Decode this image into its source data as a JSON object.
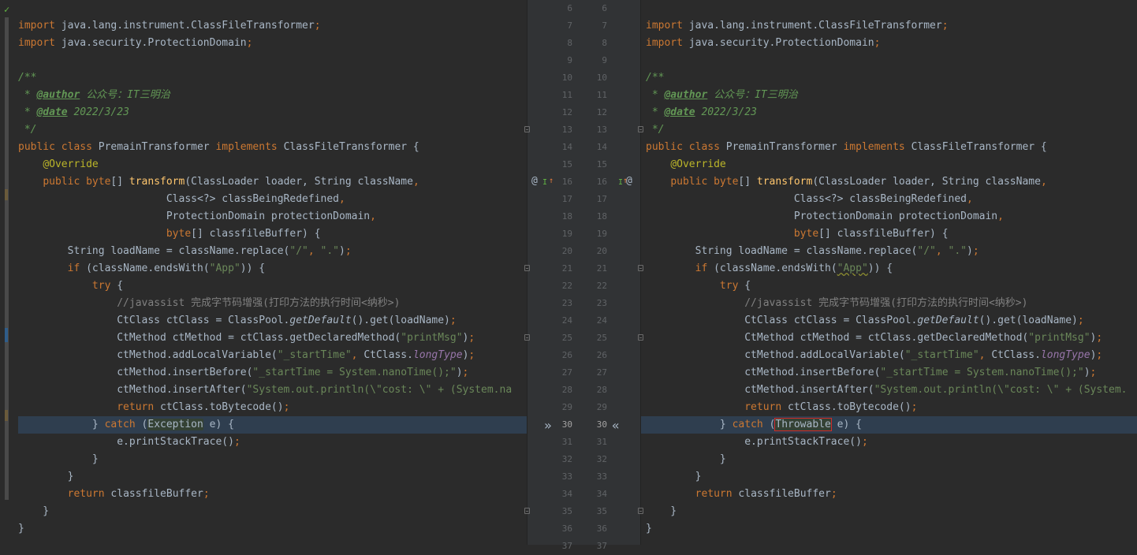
{
  "left": {
    "lines": [
      {
        "n": 7,
        "tokens": [
          [
            "k",
            "import "
          ],
          [
            "p",
            "java.lang.instrument.ClassFileTransformer"
          ],
          [
            "k",
            ";"
          ]
        ]
      },
      {
        "n": 8,
        "tokens": [
          [
            "k",
            "import "
          ],
          [
            "p",
            "java.security.ProtectionDomain"
          ],
          [
            "k",
            ";"
          ]
        ]
      },
      {
        "n": 9,
        "tokens": []
      },
      {
        "n": 10,
        "tokens": [
          [
            "dc",
            "/**"
          ]
        ]
      },
      {
        "n": 11,
        "tokens": [
          [
            "dc",
            " * "
          ],
          [
            "dt",
            "@author"
          ],
          [
            "dc",
            " 公众号：IT三明治"
          ]
        ]
      },
      {
        "n": 12,
        "tokens": [
          [
            "dc",
            " * "
          ],
          [
            "dt",
            "@date"
          ],
          [
            "dc",
            " 2022/3/23"
          ]
        ]
      },
      {
        "n": 13,
        "tokens": [
          [
            "dc",
            " */"
          ]
        ]
      },
      {
        "n": 14,
        "tokens": [
          [
            "k",
            "public class "
          ],
          [
            "p",
            "PremainTransformer "
          ],
          [
            "k",
            "implements "
          ],
          [
            "p",
            "ClassFileTransformer {"
          ]
        ]
      },
      {
        "n": 15,
        "tokens": [
          [
            "p",
            "    "
          ],
          [
            "an",
            "@Override"
          ]
        ]
      },
      {
        "n": 16,
        "tokens": [
          [
            "p",
            "    "
          ],
          [
            "k",
            "public byte"
          ],
          [
            "p",
            "[] "
          ],
          [
            "fn",
            "transform"
          ],
          [
            "p",
            "(ClassLoader loader, String className"
          ],
          [
            "k",
            ","
          ]
        ]
      },
      {
        "n": 17,
        "tokens": [
          [
            "p",
            "                        Class<?> classBeingRedefined"
          ],
          [
            "k",
            ","
          ]
        ]
      },
      {
        "n": 18,
        "tokens": [
          [
            "p",
            "                        ProtectionDomain protectionDomain"
          ],
          [
            "k",
            ","
          ]
        ]
      },
      {
        "n": 19,
        "tokens": [
          [
            "p",
            "                        "
          ],
          [
            "k",
            "byte"
          ],
          [
            "p",
            "[] classfileBuffer) {"
          ]
        ]
      },
      {
        "n": 20,
        "tokens": [
          [
            "p",
            "        String loadName = className.replace("
          ],
          [
            "s",
            "\"/\""
          ],
          [
            "k",
            ", "
          ],
          [
            "s",
            "\".\""
          ],
          [
            "p",
            ")"
          ],
          [
            "k",
            ";"
          ]
        ]
      },
      {
        "n": 21,
        "tokens": [
          [
            "p",
            "        "
          ],
          [
            "k",
            "if "
          ],
          [
            "p",
            "(className.endsWith("
          ],
          [
            "s",
            "\"App\""
          ],
          [
            "p",
            ")) {"
          ]
        ]
      },
      {
        "n": 22,
        "tokens": [
          [
            "p",
            "            "
          ],
          [
            "k",
            "try "
          ],
          [
            "p",
            "{"
          ]
        ]
      },
      {
        "n": 23,
        "tokens": [
          [
            "p",
            "                "
          ],
          [
            "c",
            "//javassist 完成字节码增强(打印方法的执行时间<纳秒>)"
          ]
        ]
      },
      {
        "n": 24,
        "tokens": [
          [
            "p",
            "                CtClass ctClass = ClassPool."
          ],
          [
            "sm",
            "getDefault"
          ],
          [
            "p",
            "().get(loadName)"
          ],
          [
            "k",
            ";"
          ]
        ]
      },
      {
        "n": 25,
        "tokens": [
          [
            "p",
            "                CtMethod ctMethod = ctClass.getDeclaredMethod("
          ],
          [
            "s",
            "\"printMsg\""
          ],
          [
            "p",
            ")"
          ],
          [
            "k",
            ";"
          ]
        ]
      },
      {
        "n": 26,
        "tokens": [
          [
            "p",
            "                ctMethod.addLocalVariable("
          ],
          [
            "s",
            "\"_startTime\""
          ],
          [
            "k",
            ", "
          ],
          [
            "p",
            "CtClass."
          ],
          [
            "it",
            "longType"
          ],
          [
            "p",
            ")"
          ],
          [
            "k",
            ";"
          ]
        ]
      },
      {
        "n": 27,
        "tokens": [
          [
            "p",
            "                ctMethod.insertBefore("
          ],
          [
            "s",
            "\"_startTime = System.nanoTime();\""
          ],
          [
            "p",
            ")"
          ],
          [
            "k",
            ";"
          ]
        ]
      },
      {
        "n": 28,
        "tokens": [
          [
            "p",
            "                ctMethod.insertAfter("
          ],
          [
            "s",
            "\"System.out.println(\\\"cost: \\\" + (System.na"
          ]
        ]
      },
      {
        "n": 29,
        "tokens": [
          [
            "p",
            "                "
          ],
          [
            "k",
            "return "
          ],
          [
            "p",
            "ctClass.toBytecode()"
          ],
          [
            "k",
            ";"
          ]
        ]
      },
      {
        "n": 30,
        "tokens": [
          [
            "p",
            "            } "
          ],
          [
            "k",
            "catch "
          ],
          [
            "p",
            "("
          ],
          [
            "mkl",
            "Exception"
          ],
          [
            "p",
            " e) {"
          ]
        ]
      },
      {
        "n": 31,
        "tokens": [
          [
            "p",
            "                e.printStackTrace()"
          ],
          [
            "k",
            ";"
          ]
        ]
      },
      {
        "n": 32,
        "tokens": [
          [
            "p",
            "            }"
          ]
        ]
      },
      {
        "n": 33,
        "tokens": [
          [
            "p",
            "        }"
          ]
        ]
      },
      {
        "n": 34,
        "tokens": [
          [
            "p",
            "        "
          ],
          [
            "k",
            "return "
          ],
          [
            "p",
            "classfileBuffer"
          ],
          [
            "k",
            ";"
          ]
        ]
      },
      {
        "n": 35,
        "tokens": [
          [
            "p",
            "    }"
          ]
        ]
      },
      {
        "n": 36,
        "tokens": [
          [
            "p",
            "}"
          ]
        ]
      }
    ]
  },
  "right": {
    "lines": [
      {
        "n": 7,
        "tokens": [
          [
            "k",
            "import "
          ],
          [
            "p",
            "java.lang.instrument.ClassFileTransformer"
          ],
          [
            "k",
            ";"
          ]
        ]
      },
      {
        "n": 8,
        "tokens": [
          [
            "k",
            "import "
          ],
          [
            "p",
            "java.security.ProtectionDomain"
          ],
          [
            "k",
            ";"
          ]
        ]
      },
      {
        "n": 9,
        "tokens": []
      },
      {
        "n": 10,
        "tokens": [
          [
            "dc",
            "/**"
          ]
        ]
      },
      {
        "n": 11,
        "tokens": [
          [
            "dc",
            " * "
          ],
          [
            "dt",
            "@author"
          ],
          [
            "dc",
            " 公众号：IT三明治"
          ]
        ]
      },
      {
        "n": 12,
        "tokens": [
          [
            "dc",
            " * "
          ],
          [
            "dt",
            "@date"
          ],
          [
            "dc",
            " 2022/3/23"
          ]
        ]
      },
      {
        "n": 13,
        "tokens": [
          [
            "dc",
            " */"
          ]
        ]
      },
      {
        "n": 14,
        "tokens": [
          [
            "k",
            "public class "
          ],
          [
            "p",
            "PremainTransformer "
          ],
          [
            "k",
            "implements "
          ],
          [
            "p",
            "ClassFileTransformer {"
          ]
        ]
      },
      {
        "n": 15,
        "tokens": [
          [
            "p",
            "    "
          ],
          [
            "an",
            "@Override"
          ]
        ]
      },
      {
        "n": 16,
        "tokens": [
          [
            "p",
            "    "
          ],
          [
            "k",
            "public byte"
          ],
          [
            "p",
            "[] "
          ],
          [
            "fn",
            "transform"
          ],
          [
            "p",
            "(ClassLoader loader, String className"
          ],
          [
            "k",
            ","
          ]
        ]
      },
      {
        "n": 17,
        "tokens": [
          [
            "p",
            "                        Class<?> classBeingRedefined"
          ],
          [
            "k",
            ","
          ]
        ]
      },
      {
        "n": 18,
        "tokens": [
          [
            "p",
            "                        ProtectionDomain protectionDomain"
          ],
          [
            "k",
            ","
          ]
        ]
      },
      {
        "n": 19,
        "tokens": [
          [
            "p",
            "                        "
          ],
          [
            "k",
            "byte"
          ],
          [
            "p",
            "[] classfileBuffer) {"
          ]
        ]
      },
      {
        "n": 20,
        "tokens": [
          [
            "p",
            "        String loadName = className.replace("
          ],
          [
            "s",
            "\"/\""
          ],
          [
            "k",
            ", "
          ],
          [
            "s",
            "\".\""
          ],
          [
            "p",
            ")"
          ],
          [
            "k",
            ";"
          ]
        ]
      },
      {
        "n": 21,
        "tokens": [
          [
            "p",
            "        "
          ],
          [
            "k",
            "if "
          ],
          [
            "p",
            "(className.endsWith("
          ],
          [
            "sq",
            "\"App\""
          ],
          [
            "p",
            ")) {"
          ]
        ]
      },
      {
        "n": 22,
        "tokens": [
          [
            "p",
            "            "
          ],
          [
            "k",
            "try "
          ],
          [
            "p",
            "{"
          ]
        ]
      },
      {
        "n": 23,
        "tokens": [
          [
            "p",
            "                "
          ],
          [
            "c",
            "//javassist 完成字节码增强(打印方法的执行时间<纳秒>)"
          ]
        ]
      },
      {
        "n": 24,
        "tokens": [
          [
            "p",
            "                CtClass ctClass = ClassPool."
          ],
          [
            "sm",
            "getDefault"
          ],
          [
            "p",
            "().get(loadName)"
          ],
          [
            "k",
            ";"
          ]
        ]
      },
      {
        "n": 25,
        "tokens": [
          [
            "p",
            "                CtMethod ctMethod = ctClass.getDeclaredMethod("
          ],
          [
            "s",
            "\"printMsg\""
          ],
          [
            "p",
            ")"
          ],
          [
            "k",
            ";"
          ]
        ]
      },
      {
        "n": 26,
        "tokens": [
          [
            "p",
            "                ctMethod.addLocalVariable("
          ],
          [
            "s",
            "\"_startTime\""
          ],
          [
            "k",
            ", "
          ],
          [
            "p",
            "CtClass."
          ],
          [
            "it",
            "longType"
          ],
          [
            "p",
            ")"
          ],
          [
            "k",
            ";"
          ]
        ]
      },
      {
        "n": 27,
        "tokens": [
          [
            "p",
            "                ctMethod.insertBefore("
          ],
          [
            "s",
            "\"_startTime = System.nanoTime();\""
          ],
          [
            "p",
            ")"
          ],
          [
            "k",
            ";"
          ]
        ]
      },
      {
        "n": 28,
        "tokens": [
          [
            "p",
            "                ctMethod.insertAfter("
          ],
          [
            "s",
            "\"System.out.println(\\\"cost: \\\" + (System."
          ]
        ]
      },
      {
        "n": 29,
        "tokens": [
          [
            "p",
            "                "
          ],
          [
            "k",
            "return "
          ],
          [
            "p",
            "ctClass.toBytecode()"
          ],
          [
            "k",
            ";"
          ]
        ]
      },
      {
        "n": 30,
        "tokens": [
          [
            "p",
            "            } "
          ],
          [
            "k",
            "catch "
          ],
          [
            "p",
            "("
          ],
          [
            "mkr",
            "Throwable"
          ],
          [
            "p",
            " e) {"
          ]
        ]
      },
      {
        "n": 31,
        "tokens": [
          [
            "p",
            "                e.printStackTrace()"
          ],
          [
            "k",
            ";"
          ]
        ]
      },
      {
        "n": 32,
        "tokens": [
          [
            "p",
            "            }"
          ]
        ]
      },
      {
        "n": 33,
        "tokens": [
          [
            "p",
            "        }"
          ]
        ]
      },
      {
        "n": 34,
        "tokens": [
          [
            "p",
            "        "
          ],
          [
            "k",
            "return "
          ],
          [
            "p",
            "classfileBuffer"
          ],
          [
            "k",
            ";"
          ]
        ]
      },
      {
        "n": 35,
        "tokens": [
          [
            "p",
            "    }"
          ]
        ]
      },
      {
        "n": 36,
        "tokens": [
          [
            "p",
            "}"
          ]
        ]
      }
    ]
  },
  "gutter": {
    "line_numbers": [
      "6",
      "7",
      "8",
      "9",
      "10",
      "11",
      "12",
      "13",
      "14",
      "15",
      "16",
      "17",
      "18",
      "19",
      "20",
      "21",
      "22",
      "23",
      "24",
      "25",
      "26",
      "27",
      "28",
      "29",
      "30",
      "31",
      "32",
      "33",
      "34",
      "35",
      "36",
      "37"
    ],
    "changed_line": "30",
    "left_chevron": "»",
    "right_chevron": "«",
    "override_icon": "@",
    "implement_icon": "I"
  },
  "colors": {
    "background": "#2b2b2b",
    "keyword": "#cc7832",
    "string": "#6a8759",
    "diff_highlight": "#2f3e4f",
    "selection_box": "#d12b2b"
  }
}
